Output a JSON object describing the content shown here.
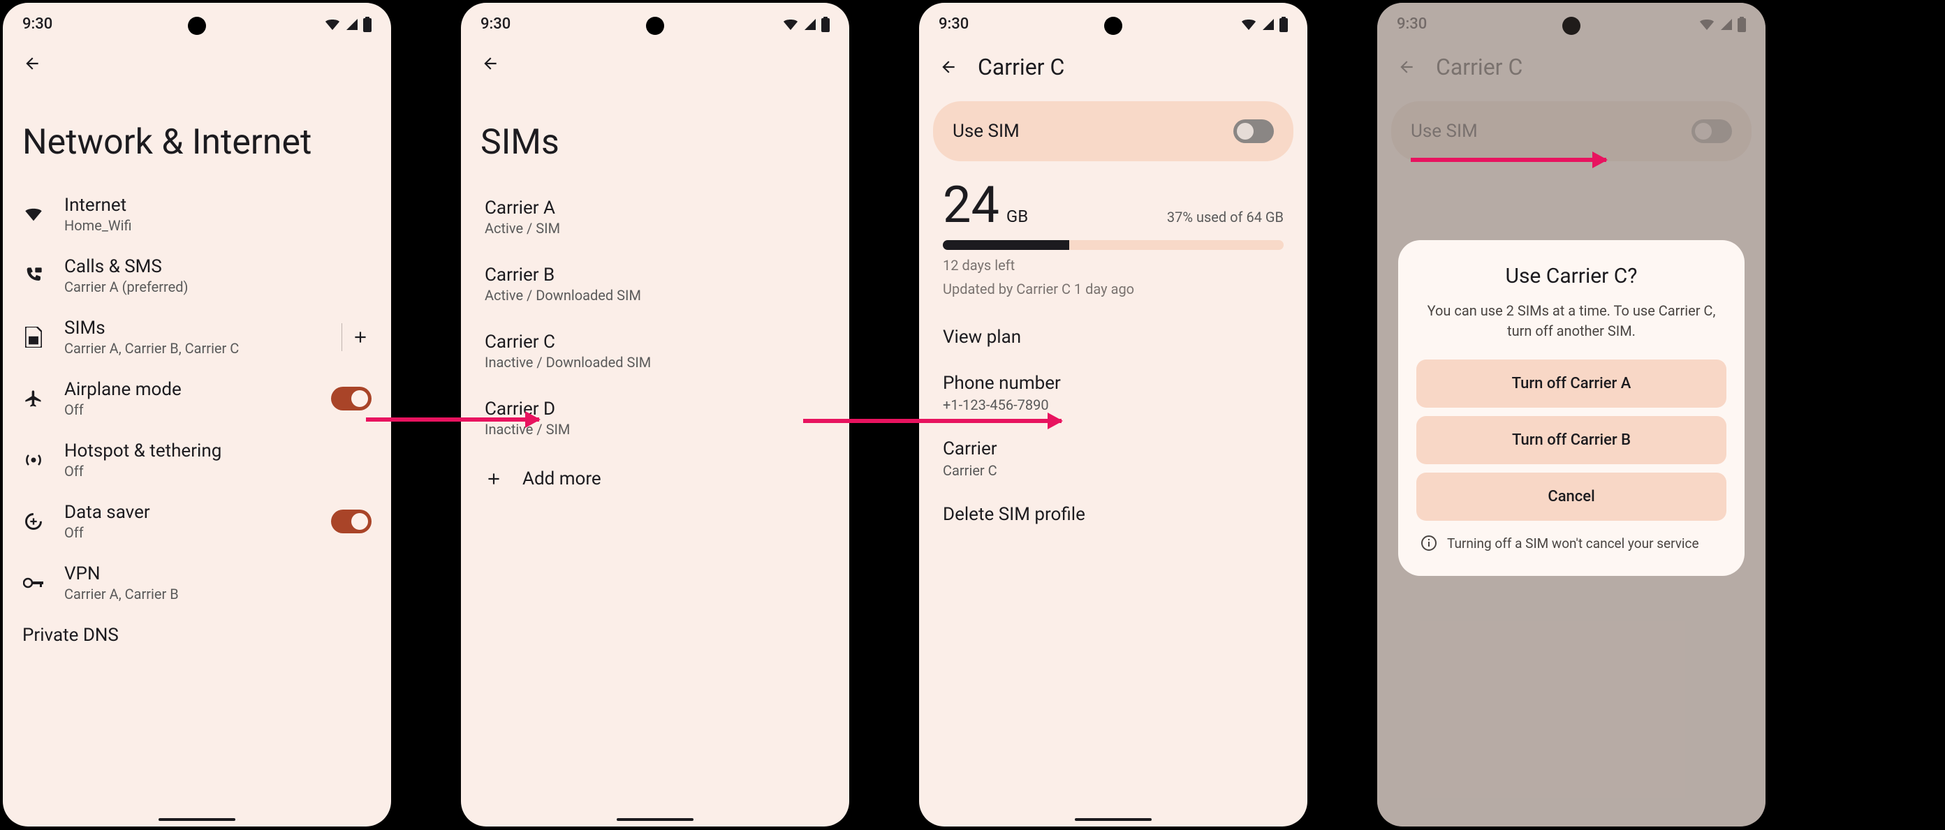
{
  "status": {
    "time": "9:30"
  },
  "screen1": {
    "title": "Network & Internet",
    "items": [
      {
        "title": "Internet",
        "sub": "Home_Wifi",
        "icon": "wifi"
      },
      {
        "title": "Calls & SMS",
        "sub": "Carrier A (preferred)",
        "icon": "phone"
      },
      {
        "title": "SIMs",
        "sub": "Carrier A, Carrier B, Carrier C",
        "icon": "sim",
        "trailing_add": true
      },
      {
        "title": "Airplane mode",
        "sub": "Off",
        "icon": "airplane",
        "toggle": true
      },
      {
        "title": "Hotspot & tethering",
        "sub": "Off",
        "icon": "hotspot"
      },
      {
        "title": "Data saver",
        "sub": "Off",
        "icon": "datasaver",
        "toggle": true
      },
      {
        "title": "VPN",
        "sub": "Carrier A, Carrier B",
        "icon": "vpn"
      }
    ],
    "private_dns": "Private DNS"
  },
  "screen2": {
    "title": "SIMs",
    "sims": [
      {
        "name": "Carrier A",
        "status": "Active / SIM"
      },
      {
        "name": "Carrier B",
        "status": "Active / Downloaded SIM"
      },
      {
        "name": "Carrier C",
        "status": "Inactive / Downloaded SIM"
      },
      {
        "name": "Carrier D",
        "status": "Inactive / SIM"
      }
    ],
    "add_more": "Add more"
  },
  "screen3": {
    "title": "Carrier C",
    "use_sim": "Use SIM",
    "data_amount": "24",
    "data_unit": "GB",
    "data_used": "37% used of 64 GB",
    "data_progress_pct": 37,
    "days_left": "12 days left",
    "updated": "Updated by Carrier C 1 day ago",
    "details": [
      {
        "title": "View plan"
      },
      {
        "title": "Phone number",
        "sub": "+1-123-456-7890"
      },
      {
        "title": "Carrier",
        "sub": "Carrier C"
      },
      {
        "title": "Delete SIM profile"
      }
    ]
  },
  "screen4": {
    "title": "Carrier C",
    "use_sim": "Use SIM",
    "dialog": {
      "title": "Use Carrier C?",
      "desc": "You can use 2 SIMs at a time. To use Carrier C, turn off another SIM.",
      "btn_a": "Turn off Carrier A",
      "btn_b": "Turn off Carrier B",
      "btn_cancel": "Cancel",
      "info": "Turning off a SIM won't cancel your service"
    }
  }
}
